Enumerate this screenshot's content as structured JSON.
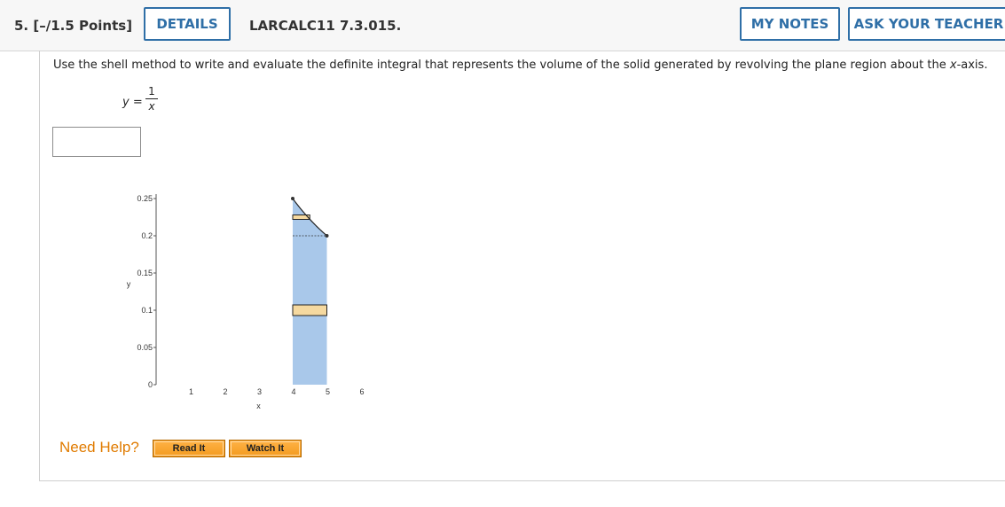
{
  "header": {
    "question_number": "5. [–/1.5 Points]",
    "details_label": "DETAILS",
    "question_code": "LARCALC11 7.3.015.",
    "my_notes_label": "MY NOTES",
    "ask_teacher_label": "ASK YOUR TEACHER"
  },
  "problem": {
    "prompt_prefix": "Use the shell method to write and evaluate the definite integral that represents the volume of the solid generated by revolving the plane region about the ",
    "prompt_var": "x",
    "prompt_suffix": "-axis.",
    "equation_lhs_var": "y",
    "equation_equals": "=",
    "fraction_numerator": "1",
    "fraction_denominator": "x",
    "answer_value": ""
  },
  "chart_data": {
    "type": "area",
    "xlabel": "x",
    "ylabel": "y",
    "x_ticks": [
      "1",
      "2",
      "3",
      "4",
      "5",
      "6"
    ],
    "y_ticks": [
      "0",
      "0.05",
      "0.1",
      "0.15",
      "0.2",
      "0.25"
    ],
    "xlim": [
      0,
      6
    ],
    "ylim": [
      0,
      0.25
    ],
    "curve": {
      "equation": "y = 1/x",
      "x_start": 4,
      "x_end": 5
    },
    "shaded_region": {
      "x_from": 4,
      "x_to": 5,
      "y_from": 0,
      "y_to_curve": true
    },
    "dashed_line_y": 0.2,
    "representative_rectangles": [
      {
        "y": 0.1,
        "x_from": 4,
        "x_to": 5
      },
      {
        "y": 0.225,
        "x_from": 4,
        "x_to": 4.5
      }
    ],
    "colors": {
      "region": "#a9c8ea",
      "rectangle": "#f5d9a0",
      "curve": "#222222"
    }
  },
  "help": {
    "label": "Need Help?",
    "read_it": "Read It",
    "watch_it": "Watch It"
  },
  "colors": {
    "accent": "#2f6fa7",
    "help": "#e07b00"
  }
}
